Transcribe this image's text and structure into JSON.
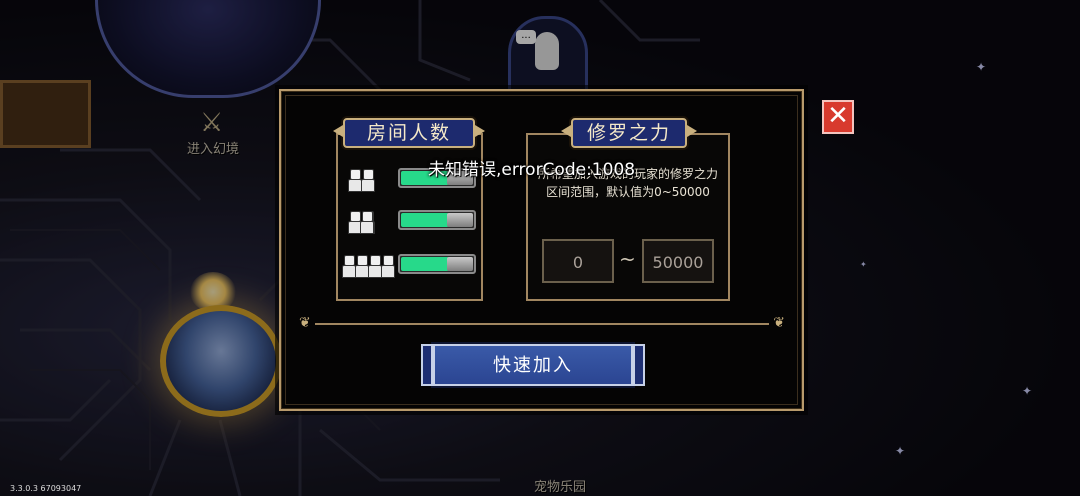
{
  "dialog": {
    "room_size": {
      "title": "房间人数",
      "options": [
        {
          "icon": "two-players-icon",
          "players": 2,
          "enabled": true
        },
        {
          "icon": "three-players-icon",
          "players": 3,
          "enabled": true
        },
        {
          "icon": "four-players-icon",
          "players": 4,
          "enabled": true
        }
      ]
    },
    "asura_power": {
      "title": "修罗之力",
      "hint": "所希望加入游戏的玩家的修罗之力区间范围，默认值为0~50000",
      "min_value": "0",
      "separator": "~",
      "max_value": "50000"
    },
    "quick_join_label": "快速加入",
    "close_icon": "close-x-icon"
  },
  "toast": {
    "message": "未知错误,errorCode:1008"
  },
  "map": {
    "enter_illusion_label": "进入幻境",
    "pet_park_label": "宠物乐园",
    "speech_bubble": "..."
  },
  "version": "3.3.0.3 67093047",
  "colors": {
    "toggle_on": "#27d98a",
    "ribbon": "#1d2a6e",
    "close": "#d83a2e",
    "border_gold": "#b89a6c"
  }
}
